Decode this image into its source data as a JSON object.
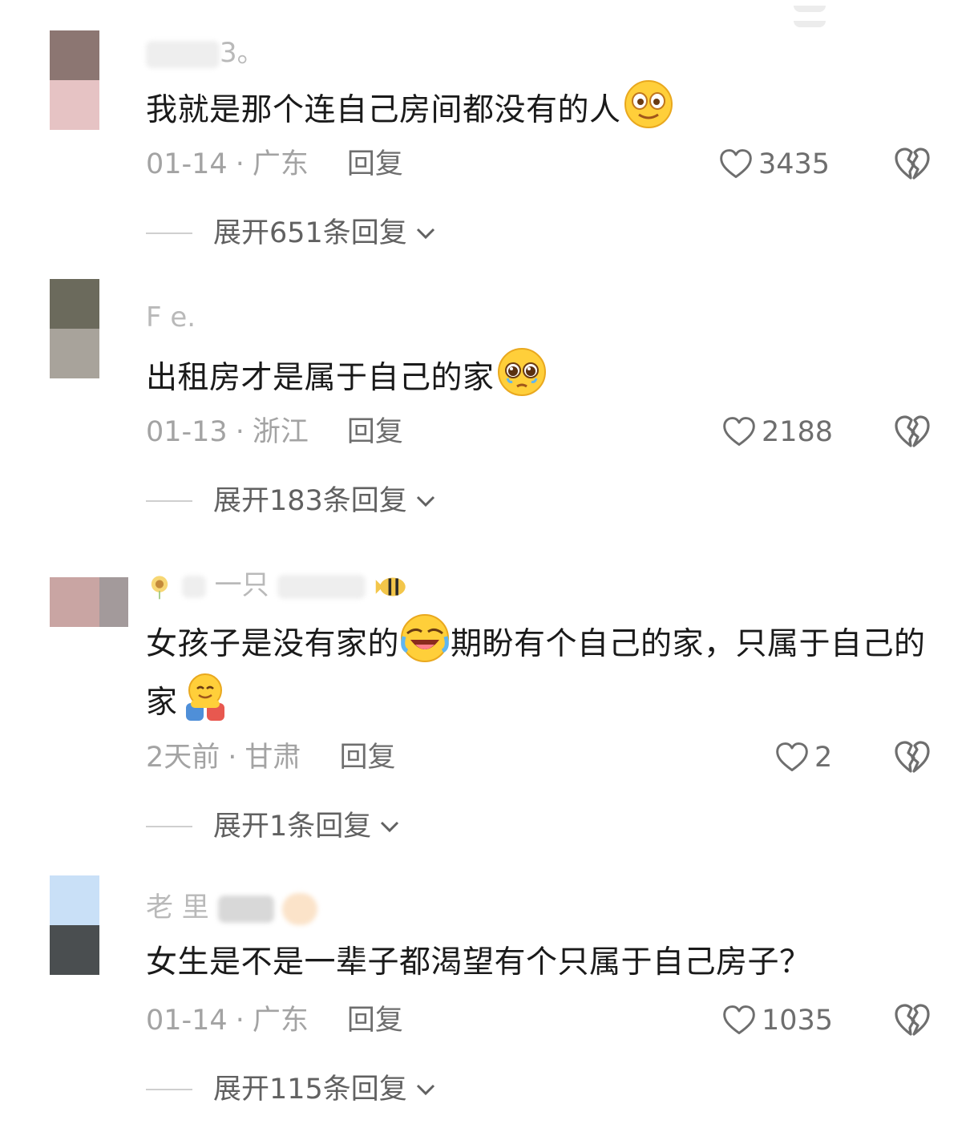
{
  "comments": [
    {
      "username": "3。",
      "text": "我就是那个连自己房间都没有的人",
      "emoji": "smiling-face-emoji",
      "date": "01-14",
      "sep": "·",
      "location": "广东",
      "reply_label": "回复",
      "likes": "3435",
      "expand_label": "展开651条回复",
      "avatar_colors": [
        "#8c7672",
        "#e6c3c4"
      ]
    },
    {
      "username": "F  e.",
      "text": "出租房才是属于自己的家",
      "emoji": "pleading-face-emoji",
      "date": "01-13",
      "sep": "·",
      "location": "浙江",
      "reply_label": "回复",
      "likes": "2188",
      "expand_label": "展开183条回复",
      "avatar_colors": [
        "#6b6a5c",
        "#a8a39b"
      ]
    },
    {
      "username": "一只",
      "text_part1": "女孩子是没有家的",
      "emoji1": "rolling-laughing-emoji",
      "text_part2": "期盼有个自己的家，只属于自己的家",
      "emoji2": "hug-emoji",
      "date": "2天前",
      "sep": "·",
      "location": "甘肃",
      "reply_label": "回复",
      "likes": "2",
      "expand_label": "展开1条回复",
      "avatar_colors": [
        "#c9a5a3",
        "#a39a9b"
      ]
    },
    {
      "username": "老 里",
      "text": "女生是不是一辈子都渴望有个只属于自己房子？",
      "date": "01-14",
      "sep": "·",
      "location": "广东",
      "reply_label": "回复",
      "likes": "1035",
      "expand_label": "展开115条回复",
      "avatar_colors": [
        "#c9e0f7",
        "#4a4e50"
      ]
    }
  ],
  "icons": {
    "like": "heart-outline-icon",
    "dislike": "broken-heart-icon",
    "expand": "chevron-down-icon"
  }
}
